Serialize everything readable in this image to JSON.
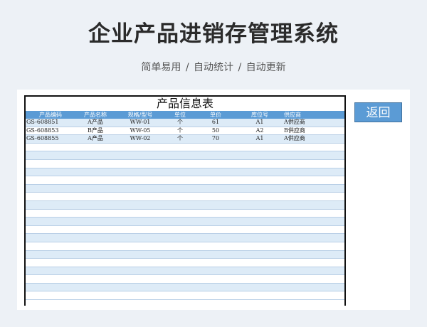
{
  "banner": {
    "title": "企业产品进销存管理系统",
    "subtitle": "简单易用  /  自动统计  /  自动更新"
  },
  "sheet": {
    "title": "产品信息表",
    "back_label": "返回",
    "headers": [
      "产品编码",
      "产品名称",
      "规格/型号",
      "单位",
      "单价",
      "库位号",
      "供应商"
    ],
    "rows": [
      [
        "GS-608851",
        "A产品",
        "WW-01",
        "个",
        "61",
        "A1",
        "A供应商"
      ],
      [
        "GS-608853",
        "B产品",
        "WW-05",
        "个",
        "50",
        "A2",
        "B供应商"
      ],
      [
        "GS-608855",
        "A产品",
        "WW-02",
        "个",
        "70",
        "A1",
        "A供应商"
      ]
    ],
    "empty_rows": 19
  },
  "colors": {
    "header_bg": "#5b9bd5",
    "stripe": "#ddebf7",
    "page_bg": "#edf1f6"
  }
}
